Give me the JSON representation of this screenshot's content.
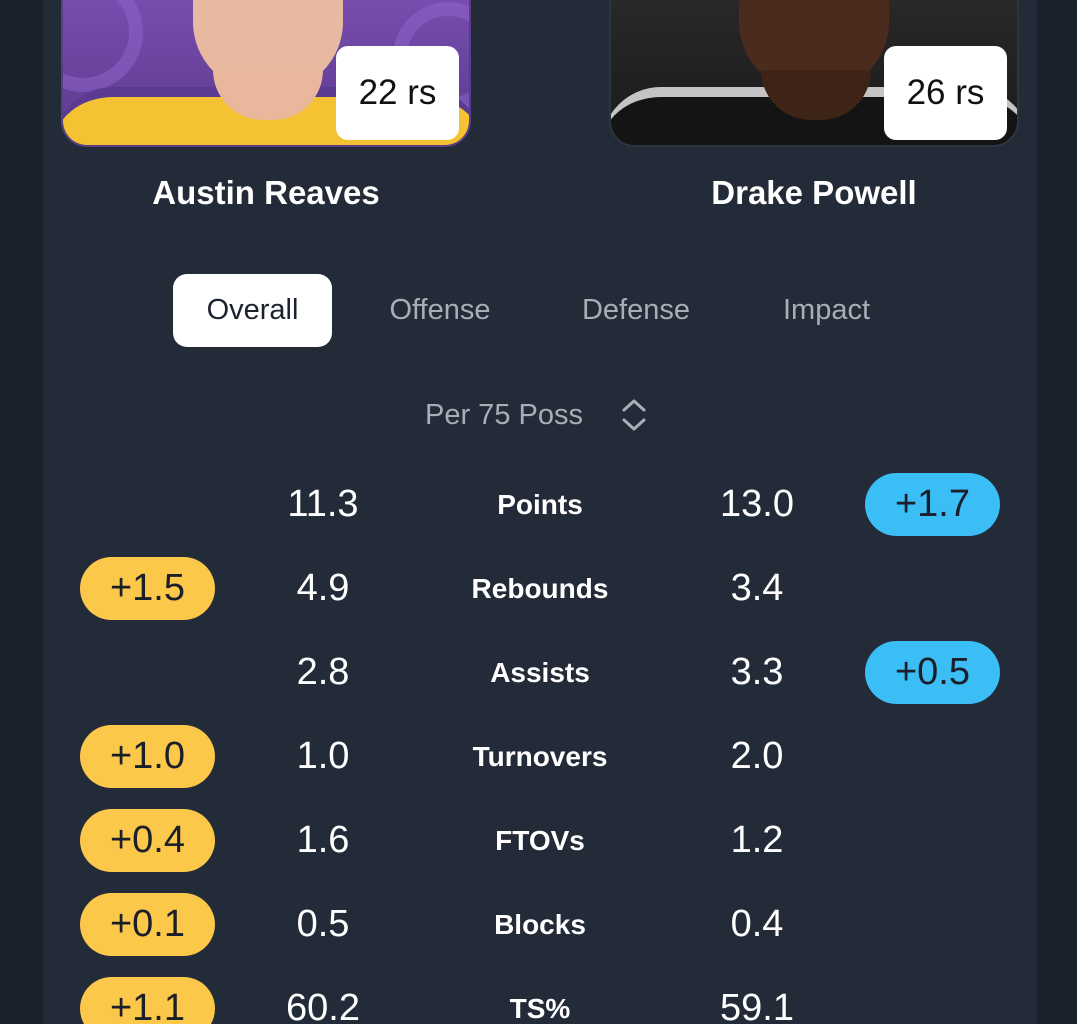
{
  "players": {
    "left": {
      "name": "Austin Reaves",
      "rs": "22 rs"
    },
    "right": {
      "name": "Drake Powell",
      "rs": "26 rs"
    }
  },
  "tabs": [
    {
      "label": "Overall",
      "active": true
    },
    {
      "label": "Offense",
      "active": false
    },
    {
      "label": "Defense",
      "active": false
    },
    {
      "label": "Impact",
      "active": false
    }
  ],
  "sort": {
    "label": "Per 75 Poss",
    "icon": "sort-updown-icon"
  },
  "colors": {
    "left_diff": "#fcc84a",
    "right_diff": "#3bbdf6",
    "card": "#232a38",
    "background": "#1b212d"
  },
  "stats": [
    {
      "label": "Points",
      "left": "11.3",
      "right": "13.0",
      "left_diff": "",
      "right_diff": "+1.7"
    },
    {
      "label": "Rebounds",
      "left": "4.9",
      "right": "3.4",
      "left_diff": "+1.5",
      "right_diff": ""
    },
    {
      "label": "Assists",
      "left": "2.8",
      "right": "3.3",
      "left_diff": "",
      "right_diff": "+0.5"
    },
    {
      "label": "Turnovers",
      "left": "1.0",
      "right": "2.0",
      "left_diff": "+1.0",
      "right_diff": ""
    },
    {
      "label": "FTOVs",
      "left": "1.6",
      "right": "1.2",
      "left_diff": "+0.4",
      "right_diff": ""
    },
    {
      "label": "Blocks",
      "left": "0.5",
      "right": "0.4",
      "left_diff": "+0.1",
      "right_diff": ""
    },
    {
      "label": "TS%",
      "left": "60.2",
      "right": "59.1",
      "left_diff": "+1.1",
      "right_diff": ""
    }
  ]
}
